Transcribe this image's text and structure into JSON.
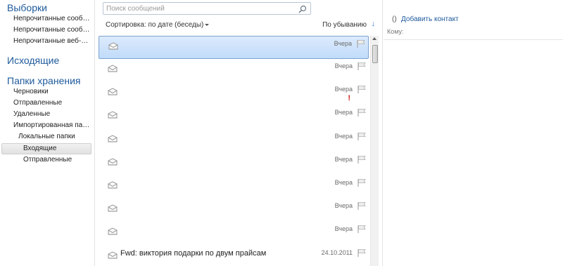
{
  "nav": {
    "favorites_heading": "Выборки",
    "favorites": [
      {
        "label": "Непрочитанные сообщ..."
      },
      {
        "label": "Непрочитанные сообщ..."
      },
      {
        "label": "Непрочитанные веб-ка..."
      }
    ],
    "outbox_heading": "Исходящие",
    "storage_heading": "Папки хранения",
    "storage_folders": [
      {
        "label": "Черновики"
      },
      {
        "label": "Отправленные"
      },
      {
        "label": "Удаленные"
      },
      {
        "label": "Импортированная папка"
      },
      {
        "label": "Локальные папки"
      }
    ],
    "local_folders": [
      {
        "label": "Входящие",
        "selected": true
      },
      {
        "label": "Отправленные",
        "selected": false
      }
    ]
  },
  "message_list": {
    "search_placeholder": "Поиск сообщений",
    "sort_label": "Сортировка: по дате (беседы)",
    "order_label": "По убыванию",
    "order_arrow": "↓",
    "messages": [
      {
        "subject": "",
        "date": "Вчера",
        "selected": true,
        "high_priority": false
      },
      {
        "subject": "",
        "date": "Вчера",
        "selected": false,
        "high_priority": false
      },
      {
        "subject": "",
        "date": "Вчера",
        "selected": false,
        "high_priority": true
      },
      {
        "subject": "",
        "date": "Вчера",
        "selected": false,
        "high_priority": false
      },
      {
        "subject": "",
        "date": "Вчера",
        "selected": false,
        "high_priority": false
      },
      {
        "subject": "",
        "date": "Вчера",
        "selected": false,
        "high_priority": false
      },
      {
        "subject": "",
        "date": "Вчера",
        "selected": false,
        "high_priority": false
      },
      {
        "subject": "",
        "date": "Вчера",
        "selected": false,
        "high_priority": false
      },
      {
        "subject": "",
        "date": "Вчера",
        "selected": false,
        "high_priority": false
      },
      {
        "subject": "Fwd: виктория подарки по двум прайсам",
        "date": "24.10.2011",
        "selected": false,
        "high_priority": false
      }
    ],
    "priority_mark": "!"
  },
  "reading_pane": {
    "contact_icon": "()",
    "add_contact_label": "Добавить контакт",
    "to_label": "Кому:"
  },
  "colors": {
    "heading_blue": "#1e5a9c",
    "selection_blue": "#c1dbfa",
    "priority_red": "#d0201b"
  },
  "icons": {
    "search": "search-icon",
    "message": "envelope-icon",
    "flag": "flag-icon",
    "priority": "high-priority-icon"
  }
}
